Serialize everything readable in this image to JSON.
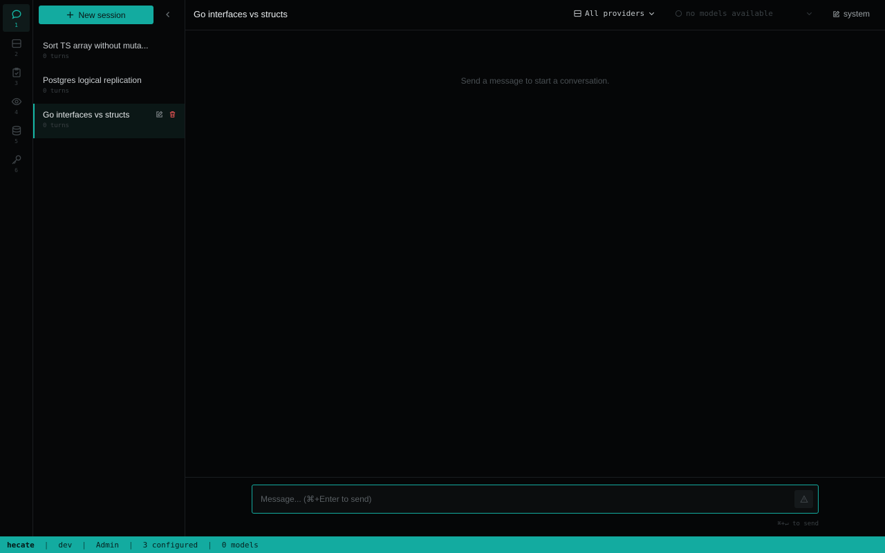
{
  "rail": {
    "items": [
      {
        "icon": "chat-bubble-icon",
        "num": "1",
        "active": true
      },
      {
        "icon": "server-icon",
        "num": "2"
      },
      {
        "icon": "clipboard-check-icon",
        "num": "3"
      },
      {
        "icon": "eye-icon",
        "num": "4"
      },
      {
        "icon": "database-icon",
        "num": "5"
      },
      {
        "icon": "key-icon",
        "num": "6"
      }
    ]
  },
  "sessions": {
    "new_label": "New session",
    "items": [
      {
        "title": "Sort TS array without muta...",
        "meta": "0 turns"
      },
      {
        "title": "Postgres logical replication",
        "meta": "0 turns"
      },
      {
        "title": "Go interfaces vs structs",
        "meta": "0 turns",
        "active": true
      }
    ]
  },
  "header": {
    "title": "Go interfaces vs structs",
    "providers_label": "All providers",
    "models_label": "no models available",
    "system_label": "system"
  },
  "main": {
    "empty_message": "Send a message to start a conversation."
  },
  "composer": {
    "placeholder": "Message... (⌘+Enter to send)",
    "hint": "⌘+↵ to send"
  },
  "statusbar": {
    "brand": "hecate",
    "env": "dev",
    "user": "Admin",
    "configured": "3 configured",
    "models": "0 models"
  },
  "colors": {
    "accent": "#13aba0",
    "background": "#050607",
    "danger": "#e05252"
  }
}
